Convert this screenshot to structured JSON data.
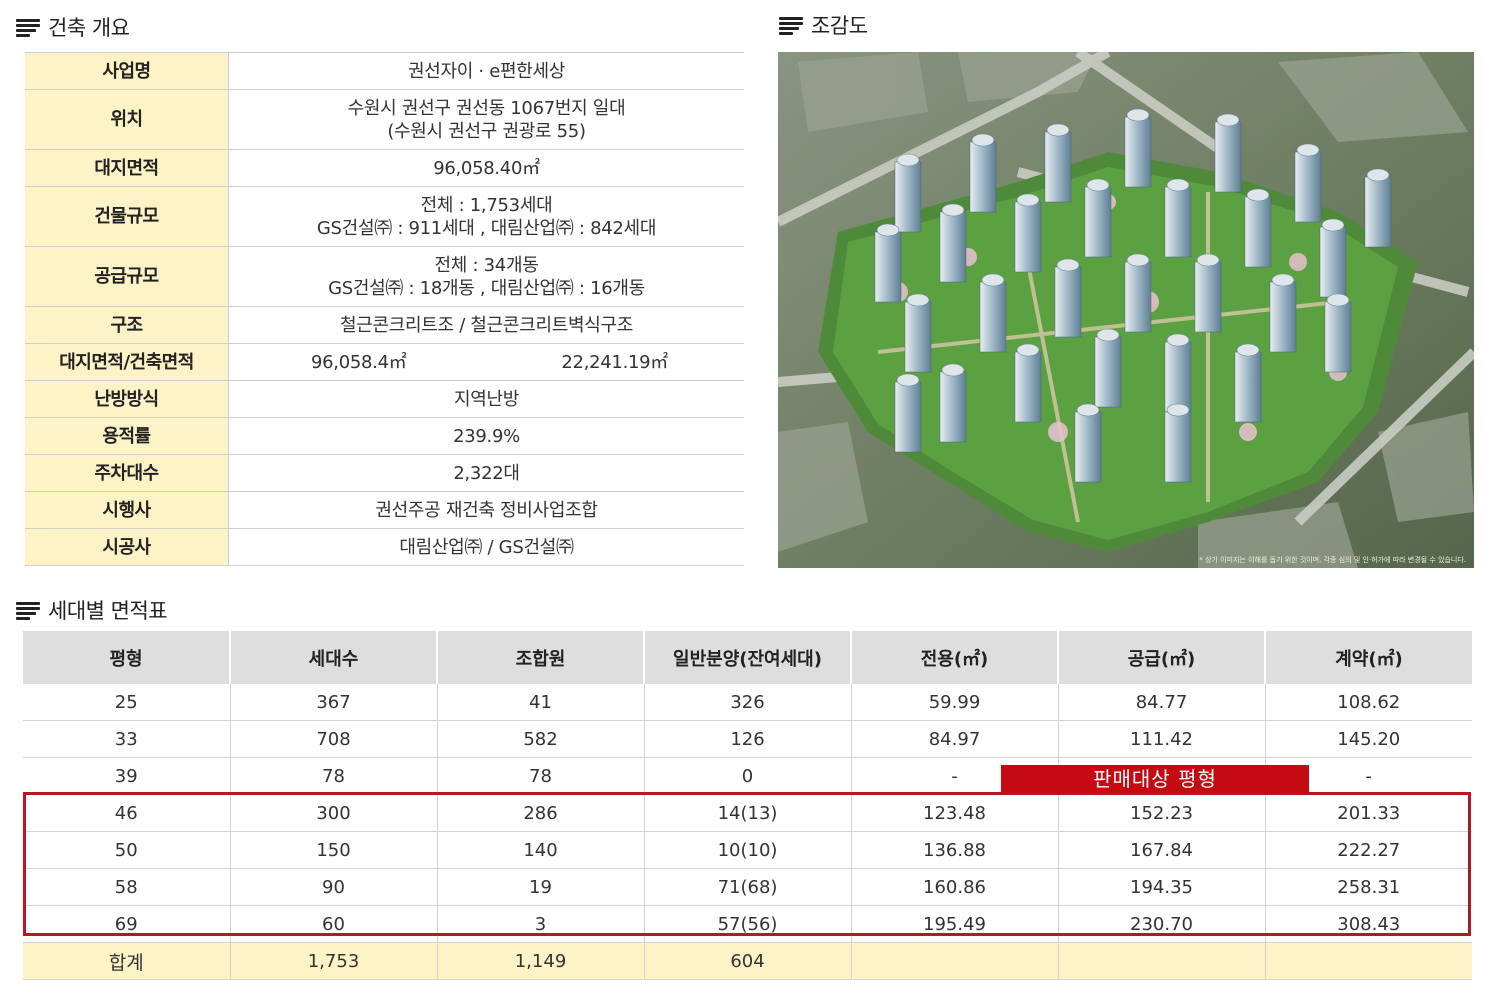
{
  "overview": {
    "title": "건축 개요",
    "rows": [
      {
        "label": "사업명",
        "lines": [
          "권선자이 · e편한세상"
        ]
      },
      {
        "label": "위치",
        "lines": [
          "수원시 권선구 권선동 1067번지 일대",
          "(수원시 권선구 권광로 55)"
        ]
      },
      {
        "label": "대지면적",
        "lines": [
          "96,058.40㎡"
        ]
      },
      {
        "label": "건물규모",
        "lines": [
          "전체 : 1,753세대",
          "GS건설㈜ : 911세대 , 대림산업㈜ : 842세대"
        ]
      },
      {
        "label": "공급규모",
        "lines": [
          "전체 : 34개동",
          "GS건설㈜ : 18개동 , 대림산업㈜ : 16개동"
        ]
      },
      {
        "label": "구조",
        "lines": [
          "철근콘크리트조 / 철근콘크리트벽식구조"
        ]
      },
      {
        "label": "대지면적/건축면적",
        "pair": [
          "96,058.4㎡",
          "22,241.19㎡"
        ]
      },
      {
        "label": "난방방식",
        "lines": [
          "지역난방"
        ]
      },
      {
        "label": "용적률",
        "lines": [
          "239.9%"
        ]
      },
      {
        "label": "주차대수",
        "lines": [
          "2,322대"
        ]
      },
      {
        "label": "시행사",
        "lines": [
          "권선주공 재건축 정비사업조합"
        ]
      },
      {
        "label": "시공사",
        "lines": [
          "대림산업㈜ / GS건설㈜"
        ]
      }
    ]
  },
  "birdseye": {
    "title": "조감도",
    "caption": "* 상기 이미지는 이해를 돕기 위한 것이며, 각종 심의 및 인·허가에 따라 변경될 수 있습니다."
  },
  "units": {
    "title": "세대별 면적표",
    "headers": [
      "평형",
      "세대수",
      "조합원",
      "일반분양(잔여세대)",
      "전용(㎡)",
      "공급(㎡)",
      "계약(㎡)"
    ],
    "rows": [
      [
        "25",
        "367",
        "41",
        "326",
        "59.99",
        "84.77",
        "108.62"
      ],
      [
        "33",
        "708",
        "582",
        "126",
        "84.97",
        "111.42",
        "145.20"
      ],
      [
        "39",
        "78",
        "78",
        "0",
        "-",
        "",
        "-"
      ],
      [
        "46",
        "300",
        "286",
        "14(13)",
        "123.48",
        "152.23",
        "201.33"
      ],
      [
        "50",
        "150",
        "140",
        "10(10)",
        "136.88",
        "167.84",
        "222.27"
      ],
      [
        "58",
        "90",
        "19",
        "71(68)",
        "160.86",
        "194.35",
        "258.31"
      ],
      [
        "69",
        "60",
        "3",
        "57(56)",
        "195.49",
        "230.70",
        "308.43"
      ]
    ],
    "total": [
      "합계",
      "1,753",
      "1,149",
      "604",
      "",
      "",
      ""
    ],
    "sale_label": "판매대상 평형"
  },
  "colors": {
    "label_bg": "#fdf3c6",
    "header_bg": "#dedede",
    "highlight": "#c40a12"
  }
}
